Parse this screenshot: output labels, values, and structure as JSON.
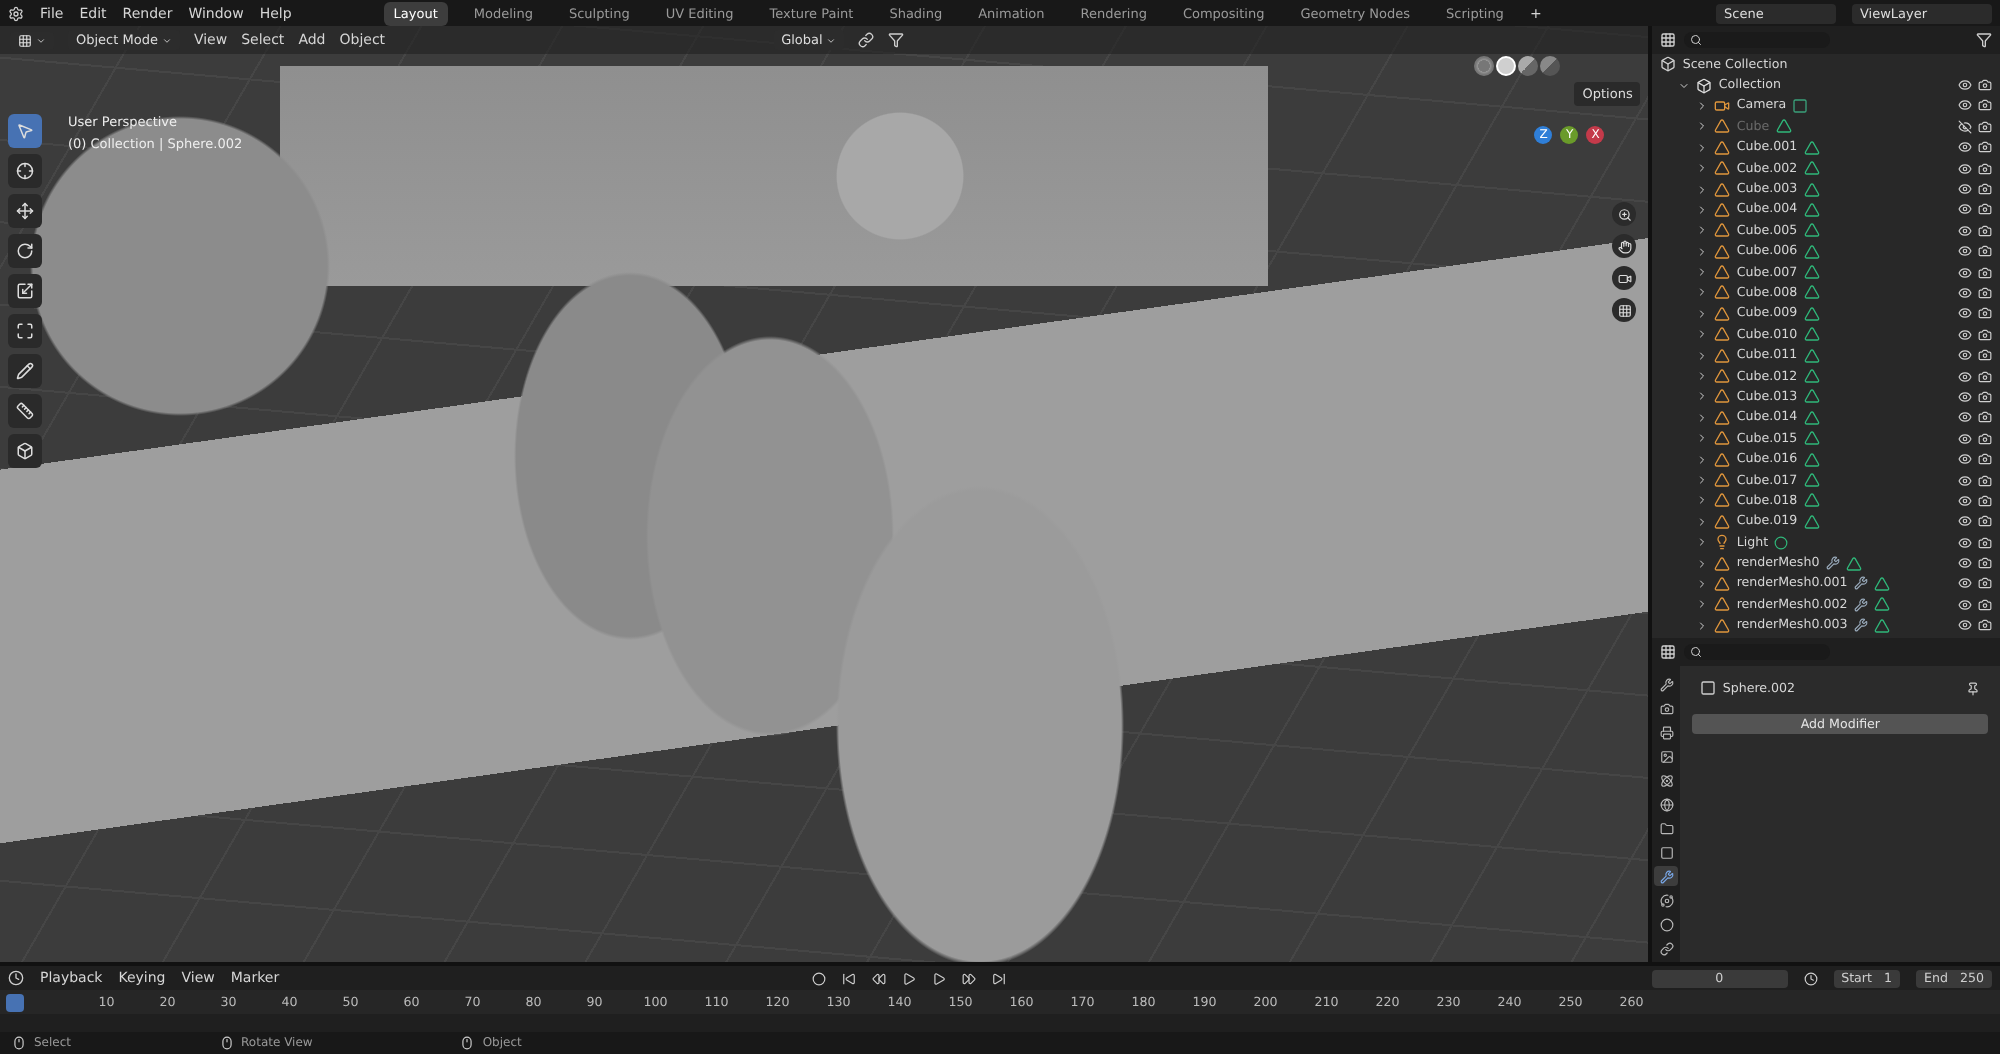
{
  "topbar": {
    "menus": [
      "File",
      "Edit",
      "Render",
      "Window",
      "Help"
    ],
    "workspaces": [
      {
        "label": "Layout",
        "selected": true
      },
      {
        "label": "Modeling",
        "selected": false
      },
      {
        "label": "Sculpting",
        "selected": false
      },
      {
        "label": "UV Editing",
        "selected": false
      },
      {
        "label": "Texture Paint",
        "selected": false
      },
      {
        "label": "Shading",
        "selected": false
      },
      {
        "label": "Animation",
        "selected": false
      },
      {
        "label": "Rendering",
        "selected": false
      },
      {
        "label": "Compositing",
        "selected": false
      },
      {
        "label": "Geometry Nodes",
        "selected": false
      },
      {
        "label": "Scripting",
        "selected": false
      }
    ],
    "add_tab": "+",
    "scene": "Scene",
    "view_layer": "ViewLayer"
  },
  "viewport": {
    "mode": "Object Mode",
    "menus": [
      "View",
      "Select",
      "Add",
      "Object"
    ],
    "orientation": "Global",
    "options": "Options",
    "info": [
      "User Perspective",
      "(0) Collection | Sphere.002"
    ],
    "tools": [
      {
        "kind": "select",
        "selected": true
      },
      {
        "kind": "cursor",
        "selected": false
      },
      {
        "kind": "move",
        "selected": false
      },
      {
        "kind": "rotate",
        "selected": false
      },
      {
        "kind": "scale",
        "selected": false
      },
      {
        "kind": "transform",
        "selected": false
      },
      {
        "kind": "annotate",
        "selected": false
      },
      {
        "kind": "measure",
        "selected": false
      },
      {
        "kind": "add-cube",
        "selected": false
      }
    ],
    "shading": [
      {
        "kind": "wireframe",
        "selected": false
      },
      {
        "kind": "solid",
        "selected": true
      },
      {
        "kind": "material",
        "selected": false
      },
      {
        "kind": "rendered",
        "selected": false
      }
    ],
    "axes": [
      "Z",
      "Y",
      "X"
    ]
  },
  "outliner": {
    "root": "Scene Collection",
    "items": [
      {
        "name": "Collection",
        "kind": "collection",
        "hidden": false,
        "expanded": true,
        "children": [
          {
            "name": "Camera",
            "kind": "camera",
            "hidden": false,
            "modifier": false
          },
          {
            "name": "Cube",
            "kind": "mesh",
            "hidden": true,
            "modifier": false
          },
          {
            "name": "Cube.001",
            "kind": "mesh",
            "hidden": false,
            "modifier": false
          },
          {
            "name": "Cube.002",
            "kind": "mesh",
            "hidden": false,
            "modifier": false
          },
          {
            "name": "Cube.003",
            "kind": "mesh",
            "hidden": false,
            "modifier": false
          },
          {
            "name": "Cube.004",
            "kind": "mesh",
            "hidden": false,
            "modifier": false
          },
          {
            "name": "Cube.005",
            "kind": "mesh",
            "hidden": false,
            "modifier": false
          },
          {
            "name": "Cube.006",
            "kind": "mesh",
            "hidden": false,
            "modifier": false
          },
          {
            "name": "Cube.007",
            "kind": "mesh",
            "hidden": false,
            "modifier": false
          },
          {
            "name": "Cube.008",
            "kind": "mesh",
            "hidden": false,
            "modifier": false
          },
          {
            "name": "Cube.009",
            "kind": "mesh",
            "hidden": false,
            "modifier": false
          },
          {
            "name": "Cube.010",
            "kind": "mesh",
            "hidden": false,
            "modifier": false
          },
          {
            "name": "Cube.011",
            "kind": "mesh",
            "hidden": false,
            "modifier": false
          },
          {
            "name": "Cube.012",
            "kind": "mesh",
            "hidden": false,
            "modifier": false
          },
          {
            "name": "Cube.013",
            "kind": "mesh",
            "hidden": false,
            "modifier": false
          },
          {
            "name": "Cube.014",
            "kind": "mesh",
            "hidden": false,
            "modifier": false
          },
          {
            "name": "Cube.015",
            "kind": "mesh",
            "hidden": false,
            "modifier": false
          },
          {
            "name": "Cube.016",
            "kind": "mesh",
            "hidden": false,
            "modifier": false
          },
          {
            "name": "Cube.017",
            "kind": "mesh",
            "hidden": false,
            "modifier": false
          },
          {
            "name": "Cube.018",
            "kind": "mesh",
            "hidden": false,
            "modifier": false
          },
          {
            "name": "Cube.019",
            "kind": "mesh",
            "hidden": false,
            "modifier": false
          },
          {
            "name": "Light",
            "kind": "light",
            "hidden": false,
            "modifier": false
          },
          {
            "name": "renderMesh0",
            "kind": "mesh",
            "hidden": false,
            "modifier": true
          },
          {
            "name": "renderMesh0.001",
            "kind": "mesh",
            "hidden": false,
            "modifier": true
          },
          {
            "name": "renderMesh0.002",
            "kind": "mesh",
            "hidden": false,
            "modifier": true
          },
          {
            "name": "renderMesh0.003",
            "kind": "mesh",
            "hidden": false,
            "modifier": true
          }
        ]
      }
    ]
  },
  "properties": {
    "object": "Sphere.002",
    "button": "Add Modifier",
    "tabs": [
      {
        "kind": "tool",
        "selected": false
      },
      {
        "kind": "render",
        "selected": false
      },
      {
        "kind": "output",
        "selected": false
      },
      {
        "kind": "view-layer",
        "selected": false
      },
      {
        "kind": "scene",
        "selected": false
      },
      {
        "kind": "world",
        "selected": false
      },
      {
        "kind": "collection",
        "selected": false
      },
      {
        "kind": "object",
        "selected": false
      },
      {
        "kind": "modifier",
        "selected": true
      },
      {
        "kind": "particles",
        "selected": false
      },
      {
        "kind": "physics",
        "selected": false
      },
      {
        "kind": "constraints",
        "selected": false
      }
    ]
  },
  "timeline": {
    "menus": [
      "Playback",
      "Keying",
      "View",
      "Marker"
    ],
    "current": "0",
    "start_label": "Start",
    "start": "1",
    "end_label": "End",
    "end": "250",
    "ticks": [
      "10",
      "20",
      "30",
      "40",
      "50",
      "60",
      "70",
      "80",
      "90",
      "100",
      "110",
      "120",
      "130",
      "140",
      "150",
      "160",
      "170",
      "180",
      "190",
      "200",
      "210",
      "220",
      "230",
      "240",
      "250",
      "260"
    ]
  },
  "status": [
    "Select",
    "Rotate View",
    "Object"
  ]
}
